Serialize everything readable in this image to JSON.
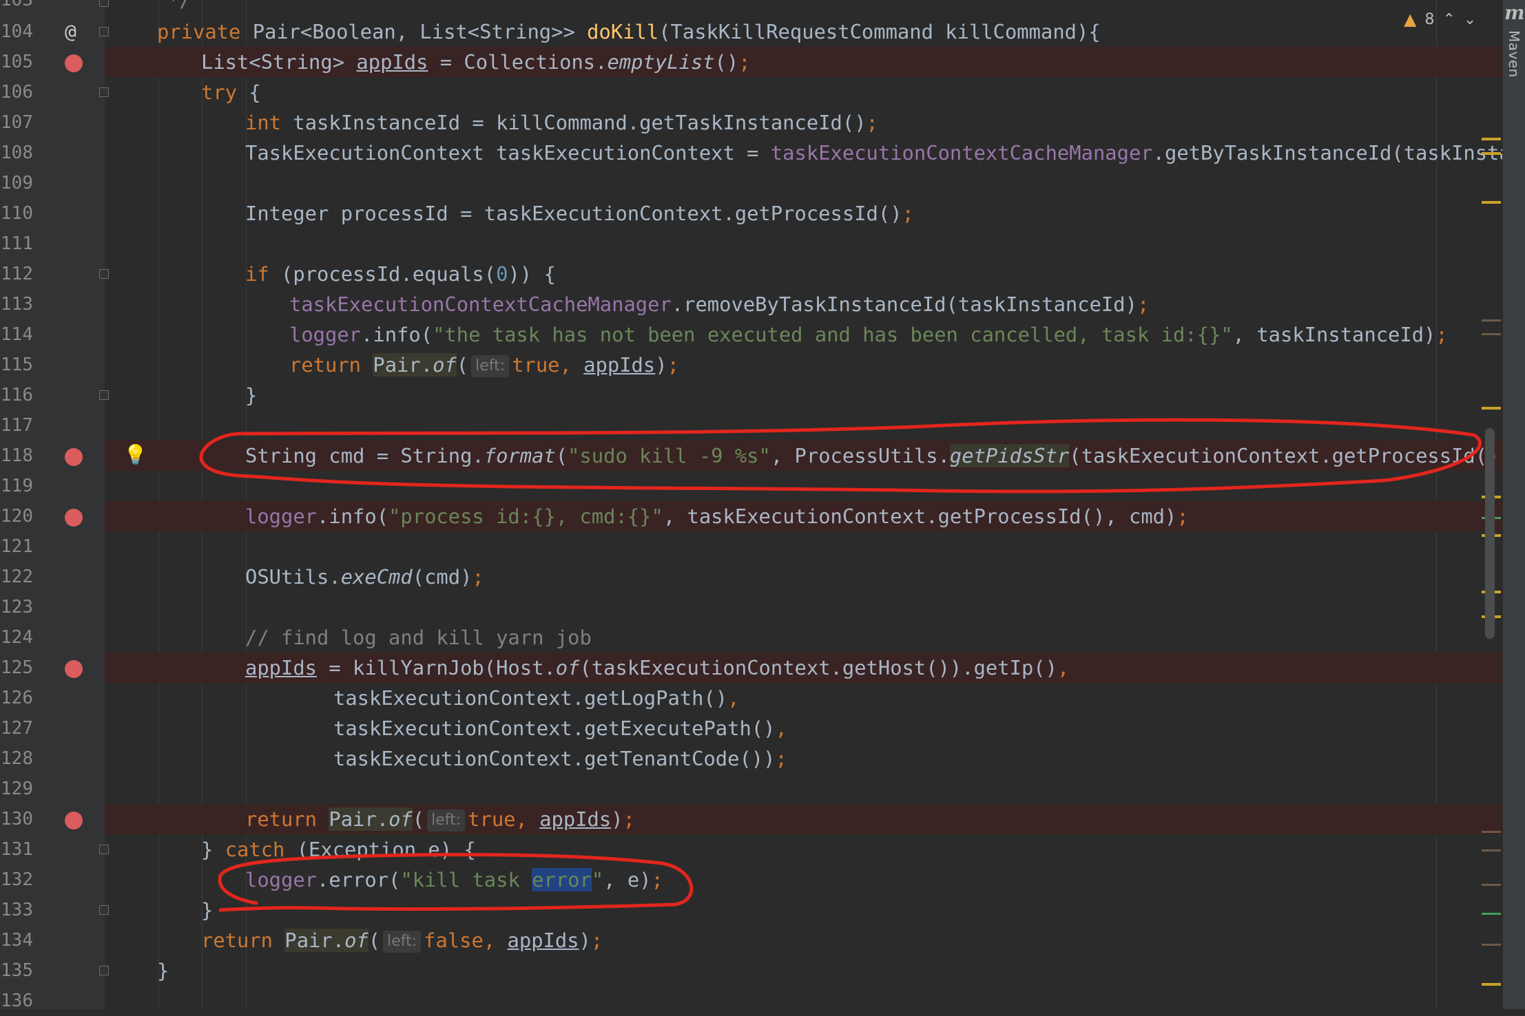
{
  "gutter": {
    "line_numbers": [
      "103",
      "104",
      "105",
      "106",
      "107",
      "108",
      "109",
      "110",
      "111",
      "112",
      "113",
      "114",
      "115",
      "116",
      "117",
      "118",
      "119",
      "120",
      "121",
      "122",
      "123",
      "124",
      "125",
      "126",
      "127",
      "128",
      "129",
      "130",
      "131",
      "132",
      "133",
      "134",
      "135",
      "136"
    ],
    "breakpoint_lines": [
      "105",
      "118",
      "120",
      "125",
      "130"
    ],
    "override_marker_line": "104",
    "override_marker_glyph": "@",
    "intention_bulb_line": "118",
    "intention_bulb_glyph": "💡"
  },
  "inspection_widget": {
    "warning_glyph": "▲",
    "warning_count": "8",
    "prev_glyph": "⌃",
    "next_glyph": "⌄"
  },
  "tool_window": {
    "maven_icon": "m",
    "maven_label": "Maven"
  },
  "hints": {
    "left": "left:"
  },
  "code": {
    "l103": "*/",
    "l104_private": "private",
    "l104_type": " Pair<Boolean, List<String>> ",
    "l104_method": "doKill",
    "l104_params": "(TaskKillRequestCommand killCommand){",
    "l105_type": "List<String> ",
    "l105_var": "appIds",
    "l105_rest": " = Collections.",
    "l105_call": "emptyList",
    "l105_end": "()",
    "l106_try": "try",
    "l106_brace": " {",
    "l107_int": "int",
    "l107_rest": " taskInstanceId = killCommand.getTaskInstanceId()",
    "l108_start": "TaskExecutionContext taskExecutionContext = ",
    "l108_field": "taskExecutionContextCacheManager",
    "l108_rest": ".getByTaskInstanceId(taskInstanceId)",
    "l110": "Integer processId = taskExecutionContext.getProcessId()",
    "l112_if": "if",
    "l112_rest1": " (processId.equals(",
    "l112_zero": "0",
    "l112_rest2": ")) {",
    "l113_field": "taskExecutionContextCacheManager",
    "l113_rest": ".removeByTaskInstanceId(taskInstanceId)",
    "l114_field": "logger",
    "l114_info": ".info(",
    "l114_str": "\"the task has not been executed and has been cancelled, task id:{}\"",
    "l114_rest": ", taskInstanceId)",
    "l115_return": "return",
    "l115_pair": "Pair.",
    "l115_of": "of",
    "l115_paren": "(",
    "l115_true": "true",
    "l115_comma": ", ",
    "l115_var": "appIds",
    "l115_end": ")",
    "l116": "}",
    "l118_start": "String cmd = String.",
    "l118_format": "format",
    "l118_paren": "(",
    "l118_str": "\"sudo kill -9 %s\"",
    "l118_mid": ", ProcessUtils.",
    "l118_call": "getPidsStr",
    "l118_rest": "(taskExecutionContext.getProcessId()))",
    "l120_field": "logger",
    "l120_info": ".info(",
    "l120_str": "\"process id:{}, cmd:{}\"",
    "l120_rest": ", taskExecutionContext.getProcessId(), cmd)",
    "l122_start": "OSUtils.",
    "l122_call": "exeCmd",
    "l122_rest": "(cmd)",
    "l124": "// find log and kill yarn job",
    "l125_var": "appIds",
    "l125_rest1": " = killYarnJob(Host.",
    "l125_of": "of",
    "l125_rest2": "(taskExecutionContext.getHost()).getIp()",
    "l126": "taskExecutionContext.getLogPath()",
    "l127": "taskExecutionContext.getExecutePath()",
    "l128": "taskExecutionContext.getTenantCode())",
    "l130_return": "return",
    "l130_pair": "Pair.",
    "l130_of": "of",
    "l130_paren": "(",
    "l130_true": "true",
    "l130_comma": ", ",
    "l130_var": "appIds",
    "l130_end": ")",
    "l131_brace": "} ",
    "l131_catch": "catch",
    "l131_rest": " (Exception e) {",
    "l132_field": "logger",
    "l132_err": ".error(",
    "l132_str1": "\"kill task ",
    "l132_sel": "error",
    "l132_str2": "\"",
    "l132_rest": ", e)",
    "l133": "}",
    "l134_return": "return",
    "l134_pair": "Pair.",
    "l134_of": "of",
    "l134_paren": "(",
    "l134_false": "false",
    "l134_comma": ", ",
    "l134_var": "appIds",
    "l134_end": ")",
    "l135": "}",
    "semi": ";",
    "comma": ","
  },
  "colors": {
    "background": "#2b2b2b",
    "breakpoint": "#db5c5c",
    "breakpoint_line": "#3a2323",
    "keyword": "#cc7832",
    "string": "#6a8759",
    "field": "#9876aa",
    "annotation_ink": "#e2261d"
  }
}
